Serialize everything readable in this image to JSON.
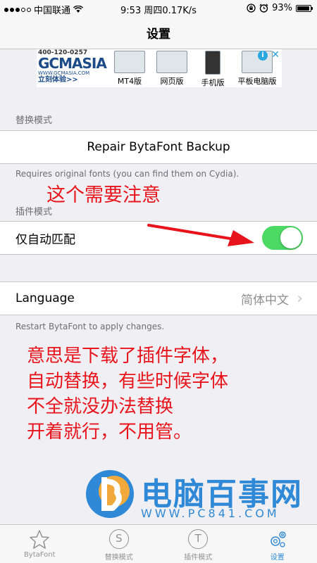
{
  "status_bar": {
    "carrier": "中国联通",
    "time_speed": "9:53 周四0.17K/s",
    "battery": "93%",
    "battery_level": 0.93
  },
  "nav": {
    "title": "设置"
  },
  "ad": {
    "phone": "400-120-0257",
    "logo": "GCMASIA",
    "site": "WWW.GCMASIA.COM",
    "try": "立刻体验>>",
    "items": [
      "MT4版",
      "网页版",
      "手机版",
      "平板电脑版"
    ],
    "info": "i",
    "close": "✕"
  },
  "sections": {
    "replace_mode": {
      "header": "替换模式",
      "button": "Repair BytaFont Backup",
      "footer": "Requires original fonts (you can find them on Cydia)."
    },
    "plugin_mode": {
      "header": "插件模式",
      "toggle_label": "仅自动匹配",
      "toggle_on": true
    },
    "language": {
      "label": "Language",
      "value": "简体中文",
      "chevron": "›",
      "footer": "Restart BytaFont to apply changes."
    }
  },
  "annotations": {
    "note_1": "这个需要注意",
    "note_2_lines": [
      "意思是下载了插件字体，",
      "自动替换，有些时候字体",
      "不全就没办法替换",
      "开着就行，不用管。"
    ]
  },
  "watermark": {
    "brand": "电脑百事网",
    "url": "WWW.PC841.COM"
  },
  "tabs": [
    {
      "label": "BytaFont",
      "icon": "star-icon"
    },
    {
      "label": "替换模式",
      "icon": "S"
    },
    {
      "label": "插件模式",
      "icon": "T"
    },
    {
      "label": "设置",
      "icon": "gear-icon"
    }
  ],
  "colors": {
    "toggle_on": "#4cd964",
    "annotation": "#e8141c",
    "accent": "#2f89d6"
  }
}
